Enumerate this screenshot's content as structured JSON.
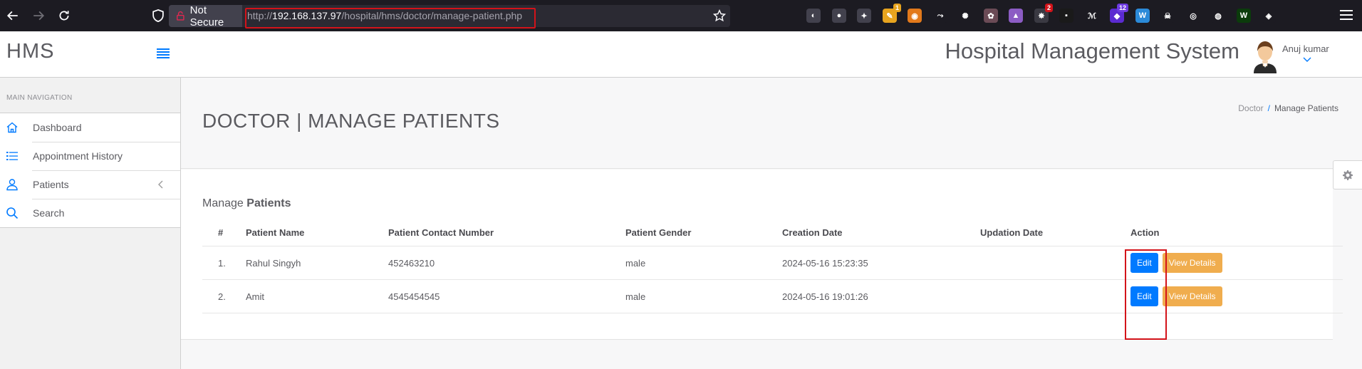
{
  "browser": {
    "security_label": "Not Secure",
    "url_prefix": "http://",
    "url_host": "192.168.137.97",
    "url_path": "/hospital/hms/doctor/manage-patient.php",
    "extensions": [
      {
        "name": "pocket-icon",
        "color": "#42414d",
        "glyph": "◐"
      },
      {
        "name": "account-icon",
        "color": "#42414d",
        "glyph": "●"
      },
      {
        "name": "extensions-icon",
        "color": "#42414d",
        "glyph": "✦"
      },
      {
        "name": "ext-orange-icon",
        "color": "#e7a41f",
        "glyph": "✎",
        "badge": "1",
        "badge_color": "#e7a41f"
      },
      {
        "name": "ext-fox-icon",
        "color": "#e2791b",
        "glyph": "◉"
      },
      {
        "name": "ext-link-icon",
        "color": "#1c1b22",
        "glyph": "⤳"
      },
      {
        "name": "ext-cookie-icon",
        "color": "#1c1b22",
        "glyph": "✺"
      },
      {
        "name": "ext-paw-icon",
        "color": "#6b4b56",
        "glyph": "✿"
      },
      {
        "name": "ext-purple-icon",
        "color": "#8c5cc4",
        "glyph": "▲"
      },
      {
        "name": "ext-red-badge-icon",
        "color": "#3a3942",
        "glyph": "✸",
        "badge": "2",
        "badge_color": "#d3131a"
      },
      {
        "name": "ext-dark-red-icon",
        "color": "#1a1a1a",
        "glyph": "▪"
      },
      {
        "name": "ext-wappalyzer-icon",
        "color": "#1c1b22",
        "glyph": "ℳ"
      },
      {
        "name": "ext-twelve-icon",
        "color": "#5b2bd1",
        "glyph": "◆",
        "badge": "12",
        "badge_color": "#6d3ae0"
      },
      {
        "name": "ext-w-icon",
        "color": "#2b8ad8",
        "glyph": "W"
      },
      {
        "name": "ext-skull-icon",
        "color": "#1c1b22",
        "glyph": "☠"
      },
      {
        "name": "ext-target-icon",
        "color": "#1c1b22",
        "glyph": "◎"
      },
      {
        "name": "ext-globe-icon",
        "color": "#1c1b22",
        "glyph": "◍"
      },
      {
        "name": "ext-green-icon",
        "color": "#0b3b0b",
        "glyph": "W"
      },
      {
        "name": "ext-puzzle-icon",
        "color": "#1c1b22",
        "glyph": "◈"
      }
    ]
  },
  "sidebar": {
    "brand": "HMS",
    "nav_title": "MAIN NAVIGATION",
    "items": [
      {
        "label": "Dashboard",
        "icon": "home-icon"
      },
      {
        "label": "Appointment History",
        "icon": "list-icon"
      },
      {
        "label": "Patients",
        "icon": "user-icon"
      },
      {
        "label": "Search",
        "icon": "search-icon"
      }
    ]
  },
  "header": {
    "title": "Hospital Management System",
    "user_name": "Anuj kumar"
  },
  "page": {
    "title": "DOCTOR | MANAGE PATIENTS",
    "breadcrumb_parent": "Doctor",
    "breadcrumb_separator": "/",
    "breadcrumb_current": "Manage Patients"
  },
  "panel": {
    "title_light": "Manage",
    "title_bold": "Patients"
  },
  "table": {
    "columns": [
      "#",
      "Patient Name",
      "Patient Contact Number",
      "Patient Gender",
      "Creation Date",
      "Updation Date",
      "Action"
    ],
    "rows": [
      {
        "num": "1.",
        "name": "Rahul Singyh",
        "contact": "452463210",
        "gender": "male",
        "created": "2024-05-16 15:23:35",
        "updated": "",
        "edit": "Edit",
        "view": "View Details"
      },
      {
        "num": "2.",
        "name": "Amit",
        "contact": "4545454545",
        "gender": "male",
        "created": "2024-05-16 19:01:26",
        "updated": "",
        "edit": "Edit",
        "view": "View Details"
      }
    ]
  },
  "colors": {
    "accent": "#007aff",
    "warning": "#f0ad4e",
    "annotation": "#d3131a",
    "browser_bg": "#1c1b22"
  }
}
